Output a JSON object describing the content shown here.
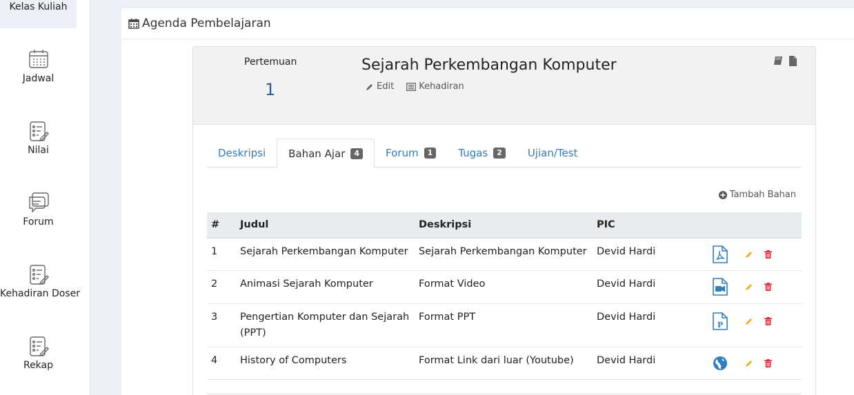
{
  "sidebar": {
    "items": [
      {
        "label": "Kelas Kuliah",
        "icon": "book-icon"
      },
      {
        "label": "Jadwal",
        "icon": "calendar-icon"
      },
      {
        "label": "Nilai",
        "icon": "checklist-icon"
      },
      {
        "label": "Forum",
        "icon": "chat-icon"
      },
      {
        "label": "Kehadiran Doser",
        "icon": "checklist-icon"
      },
      {
        "label": "Rekap",
        "icon": "checklist-icon"
      }
    ]
  },
  "panel": {
    "title": "Agenda Pembelajaran"
  },
  "session": {
    "pertemuan_label": "Pertemuan",
    "pertemuan_number": "1",
    "title": "Sejarah Perkembangan Komputer",
    "edit_label": "Edit",
    "kehadiran_label": "Kehadiran"
  },
  "tabs": [
    {
      "label": "Deskripsi",
      "badge": null,
      "active": false
    },
    {
      "label": "Bahan Ajar",
      "badge": "4",
      "active": true
    },
    {
      "label": "Forum",
      "badge": "1",
      "active": false
    },
    {
      "label": "Tugas",
      "badge": "2",
      "active": false
    },
    {
      "label": "Ujian/Test",
      "badge": null,
      "active": false
    }
  ],
  "add_material_label": "Tambah Bahan",
  "table": {
    "headers": [
      "#",
      "Judul",
      "Deskripsi",
      "PIC"
    ],
    "rows": [
      {
        "no": "1",
        "judul": "Sejarah Perkembangan Komputer",
        "deskripsi": "Sejarah Perkembangan Komputer",
        "pic": "Devid Hardi",
        "type_icon": "pdf-file-icon"
      },
      {
        "no": "2",
        "judul": "Animasi Sejarah Komputer",
        "deskripsi": "Format Video",
        "pic": "Devid Hardi",
        "type_icon": "video-file-icon"
      },
      {
        "no": "3",
        "judul": "Pengertian Komputer dan Sejarah (PPT)",
        "deskripsi": "Format PPT",
        "pic": "Devid Hardi",
        "type_icon": "ppt-file-icon"
      },
      {
        "no": "4",
        "judul": "History of Computers",
        "deskripsi": "Format Link dari luar (Youtube)",
        "pic": "Devid Hardi",
        "type_icon": "globe-icon"
      }
    ]
  },
  "colors": {
    "link": "#337ab7",
    "edit_icon": "#f0ad1a",
    "delete_icon": "#d9232e",
    "file_icon": "#2f7fc1"
  }
}
